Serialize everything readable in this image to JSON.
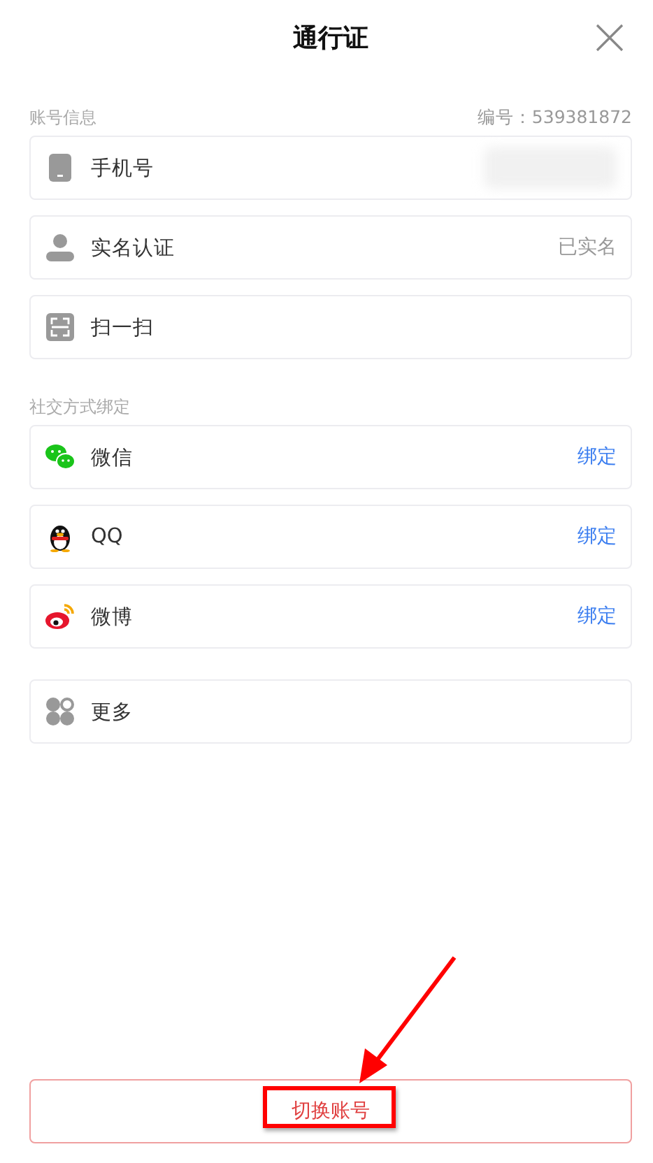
{
  "header": {
    "title": "通行证"
  },
  "account_section": {
    "label": "账号信息",
    "number": "编号：539381872"
  },
  "account_items": [
    {
      "kind": "phone",
      "label": "手机号",
      "value_blurred": true
    },
    {
      "kind": "person",
      "label": "实名认证",
      "value": "已实名"
    },
    {
      "kind": "scan",
      "label": "扫一扫"
    }
  ],
  "social_section": {
    "label": "社交方式绑定"
  },
  "social_items": [
    {
      "kind": "wechat",
      "label": "微信",
      "action": "绑定"
    },
    {
      "kind": "qq",
      "label": "QQ",
      "action": "绑定"
    },
    {
      "kind": "weibo",
      "label": "微博",
      "action": "绑定"
    }
  ],
  "more_item": {
    "kind": "more",
    "label": "更多"
  },
  "switch_button": {
    "label": "切换账号",
    "highlighted": true
  }
}
